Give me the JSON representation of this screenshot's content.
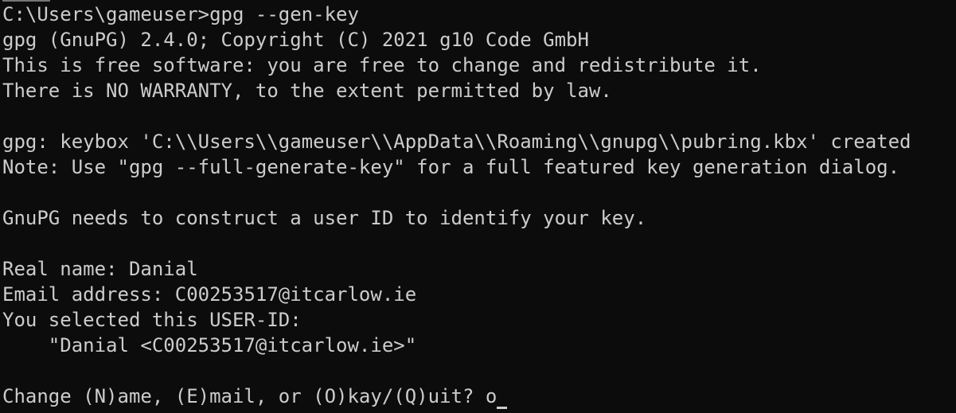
{
  "terminal": {
    "lines": [
      "C:\\Users\\gameuser>gpg --gen-key",
      "gpg (GnuPG) 2.4.0; Copyright (C) 2021 g10 Code GmbH",
      "This is free software: you are free to change and redistribute it.",
      "There is NO WARRANTY, to the extent permitted by law.",
      "",
      "gpg: keybox 'C:\\\\Users\\\\gameuser\\\\AppData\\\\Roaming\\\\gnupg\\\\pubring.kbx' created",
      "Note: Use \"gpg --full-generate-key\" for a full featured key generation dialog.",
      "",
      "GnuPG needs to construct a user ID to identify your key.",
      "",
      "Real name: Danial",
      "Email address: C00253517@itcarlow.ie",
      "You selected this USER-ID:",
      "    \"Danial <C00253517@itcarlow.ie>\"",
      "",
      "Change (N)ame, (E)mail, or (O)kay/(Q)uit? o"
    ],
    "colors": {
      "background": "#0c0c0c",
      "foreground": "#cccccc"
    }
  }
}
